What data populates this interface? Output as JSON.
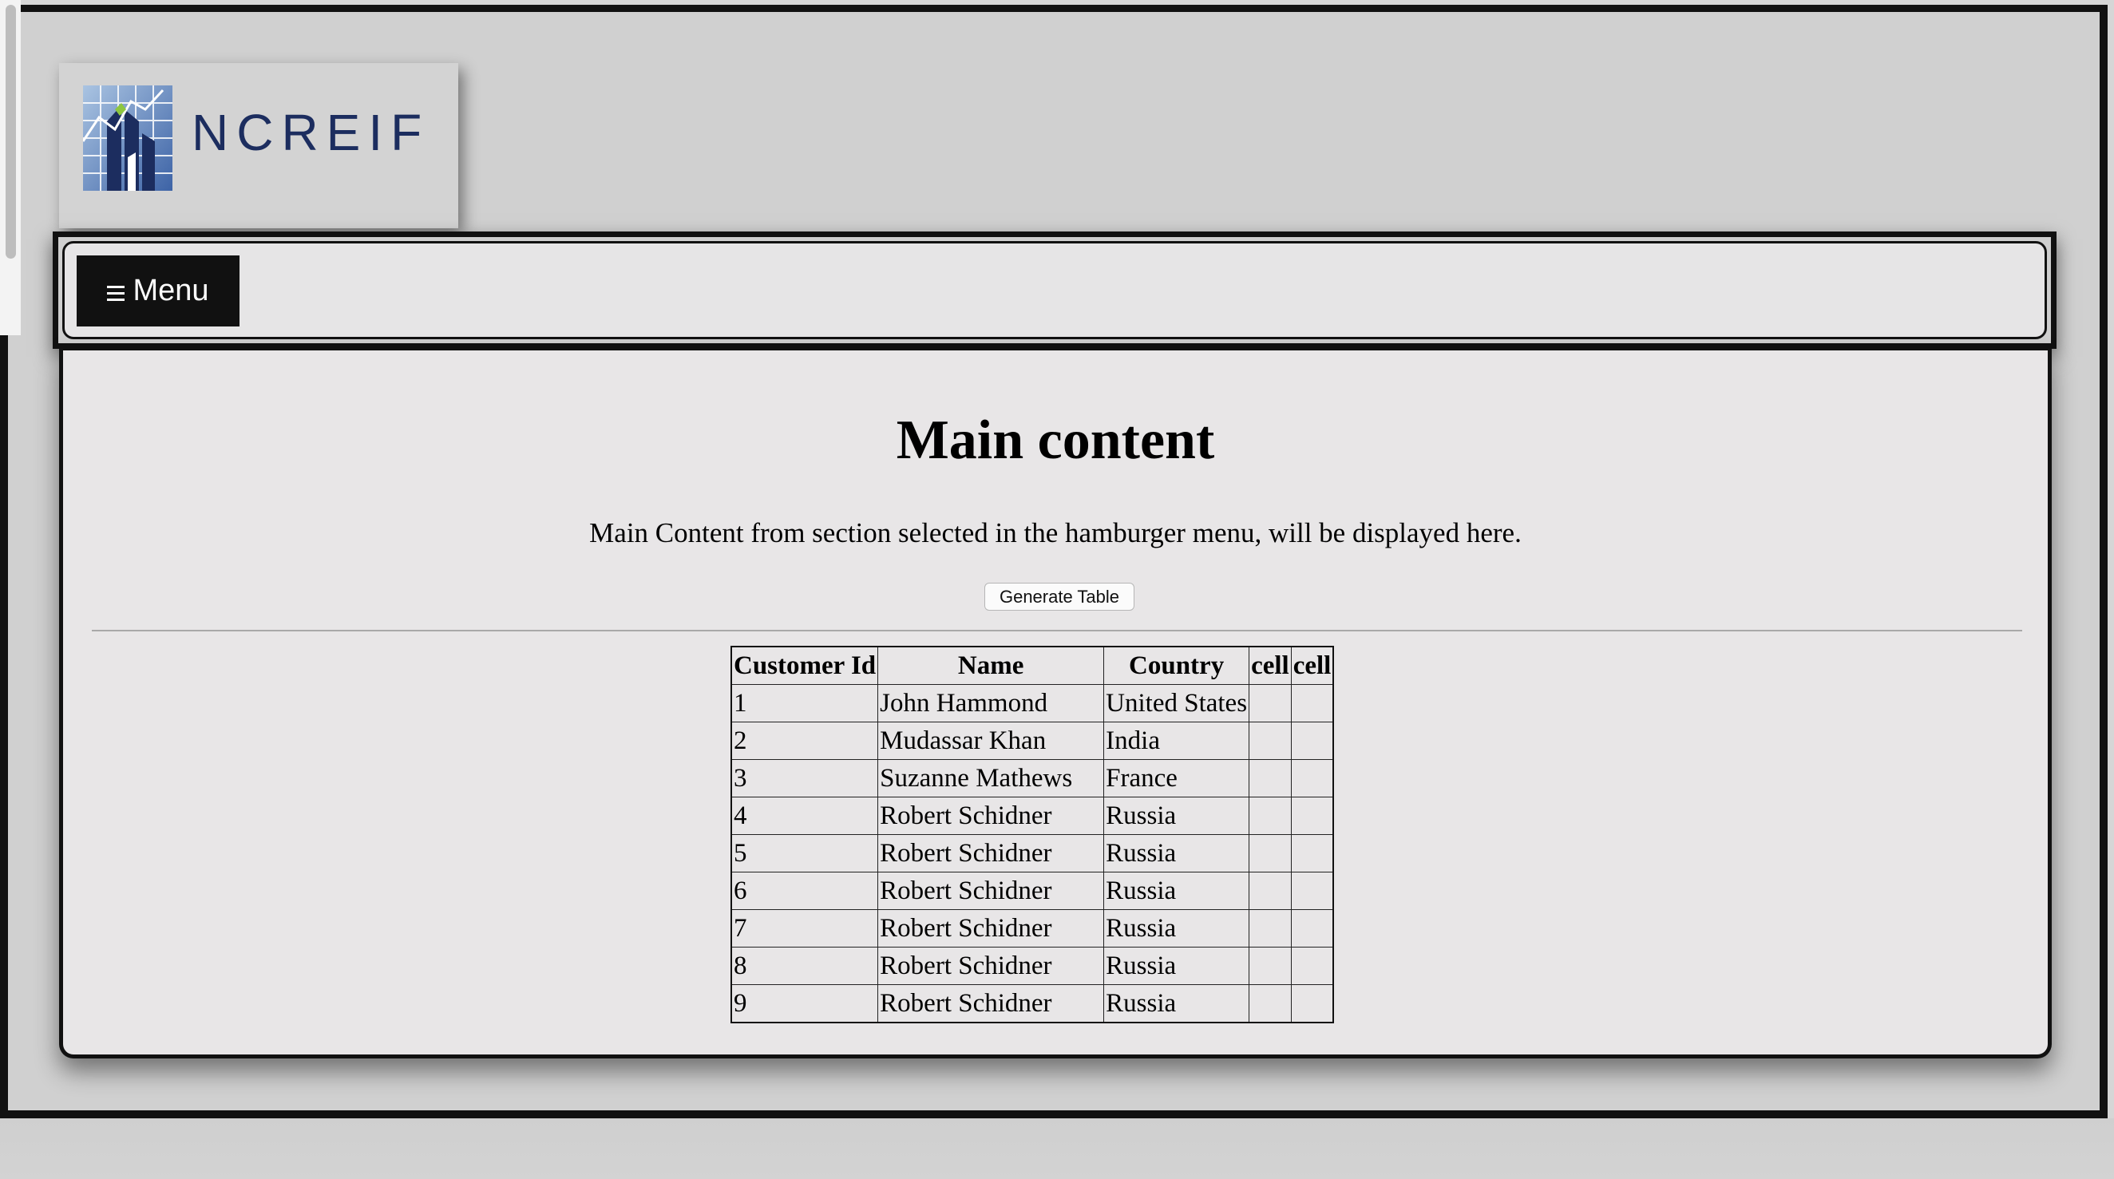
{
  "logo": {
    "text": "NCREIF"
  },
  "nav": {
    "menu_label": "Menu",
    "menu_icon": "hamburger-icon"
  },
  "main": {
    "title": "Main content",
    "description": "Main Content from section selected in the hamburger menu, will be displayed here.",
    "generate_button": "Generate Table"
  },
  "table": {
    "headers": [
      "Customer Id",
      "Name",
      "Country",
      "cell",
      "cell"
    ],
    "rows": [
      [
        "1",
        "John Hammond",
        "United States",
        "",
        ""
      ],
      [
        "2",
        "Mudassar Khan",
        "India",
        "",
        ""
      ],
      [
        "3",
        "Suzanne Mathews",
        "France",
        "",
        ""
      ],
      [
        "4",
        "Robert Schidner",
        "Russia",
        "",
        ""
      ],
      [
        "5",
        "Robert Schidner",
        "Russia",
        "",
        ""
      ],
      [
        "6",
        "Robert Schidner",
        "Russia",
        "",
        ""
      ],
      [
        "7",
        "Robert Schidner",
        "Russia",
        "",
        ""
      ],
      [
        "8",
        "Robert Schidner",
        "Russia",
        "",
        ""
      ],
      [
        "9",
        "Robert Schidner",
        "Russia",
        "",
        ""
      ]
    ]
  },
  "colors": {
    "brand_navy": "#1c2d5f",
    "menu_bg": "#111111",
    "panel_bg": "#e8e6e7"
  }
}
